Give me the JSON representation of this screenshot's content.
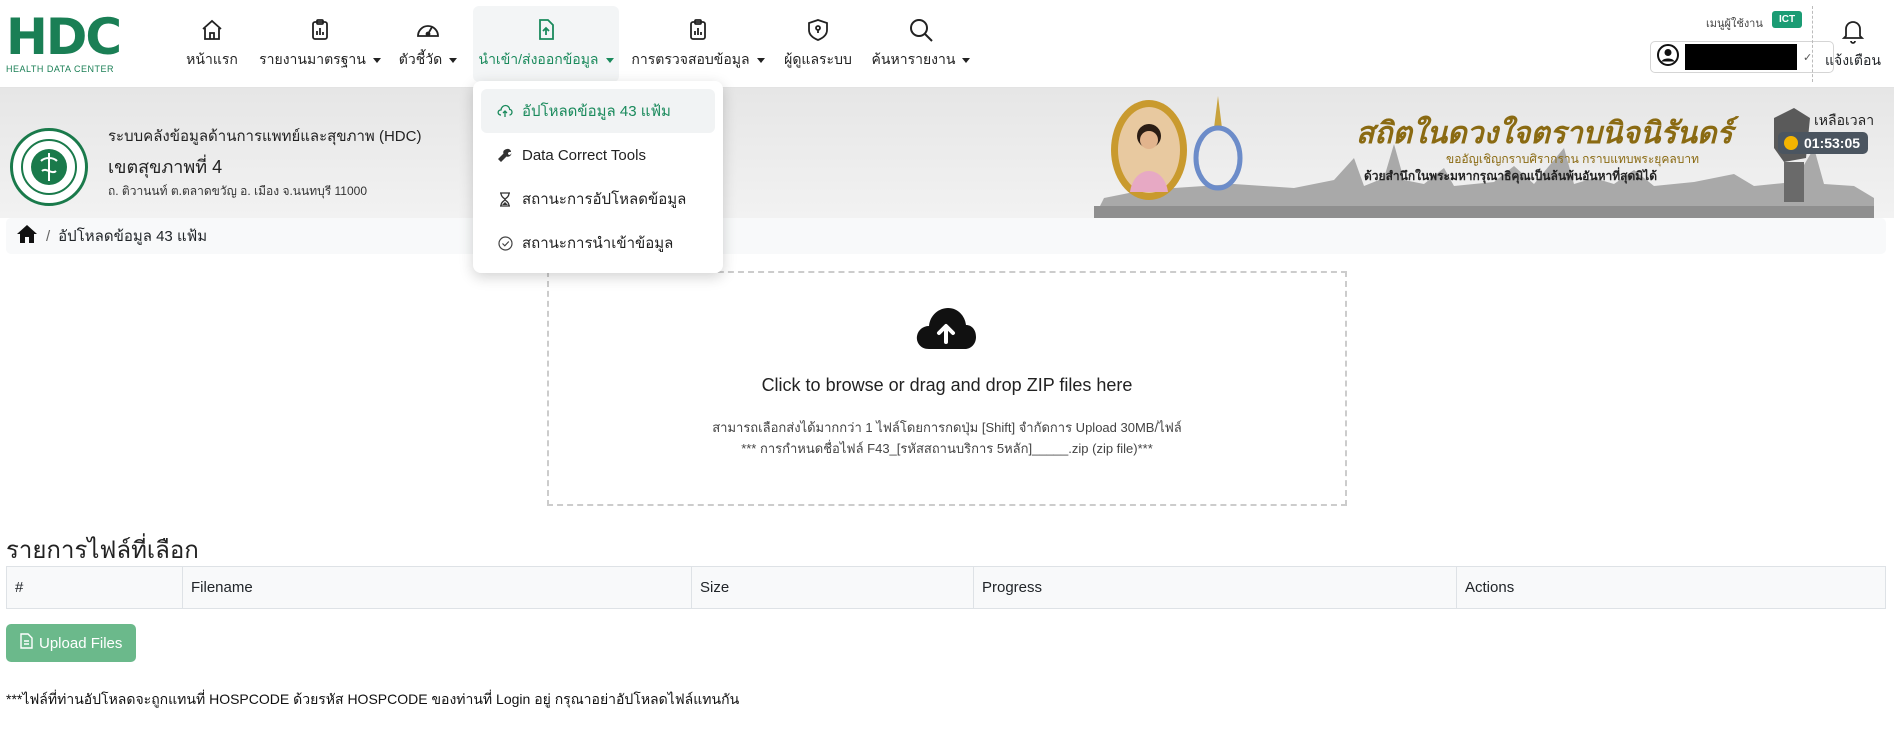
{
  "app": {
    "logo_text": "HDC",
    "logo_sub": "HEALTH DATA CENTER"
  },
  "nav": {
    "items": [
      {
        "label": "หน้าแรก",
        "icon": "home-icon"
      },
      {
        "label": "รายงานมาตรฐาน",
        "icon": "report-clipboard-icon"
      },
      {
        "label": "ตัวชี้วัด",
        "icon": "gauge-icon"
      },
      {
        "label": "นำเข้า/ส่งออกข้อมูล",
        "icon": "file-upload-icon"
      },
      {
        "label": "การตรวจสอบข้อมูล",
        "icon": "clipboard-check-icon"
      },
      {
        "label": "ผู้ดูแลระบบ",
        "icon": "shield-icon"
      },
      {
        "label": "ค้นหารายงาน",
        "icon": "search-icon"
      }
    ],
    "user_menu_label": "เมนูผู้ใช้งาน",
    "user_badge": "ICT",
    "notifications_label": "แจ้งเตือน"
  },
  "dropdown": {
    "items": [
      {
        "label": "อัปโหลดข้อมูล 43 แฟ้ม",
        "icon": "cloud-upload-icon"
      },
      {
        "label": "Data Correct Tools",
        "icon": "wrench-icon"
      },
      {
        "label": "สถานะการอัปโหลดข้อมูล",
        "icon": "hourglass-icon"
      },
      {
        "label": "สถานะการนำเข้าข้อมูล",
        "icon": "check-circle-icon"
      }
    ]
  },
  "header": {
    "site_name": "ระบบคลังข้อมูลด้านการแพทย์และสุขภาพ (HDC)",
    "region": "เขตสุขภาพที่ 4",
    "address": "ถ. ติวานนท์ ต.ตลาดขวัญ อ. เมือง จ.นนทบุรี 11000",
    "banner_title": "สถิตในดวงใจตราบนิจนิรันดร์",
    "banner_line1": "ขออัญเชิญกราบศิรากราน กราบแทบพระยุคลบาท",
    "banner_line2": "ด้วยสำนึกในพระมหากรุณาธิคุณเป็นล้นพ้นอันหาที่สุดมิได้",
    "time_left_label": "เหลือเวลา",
    "time_left": "01:53:05"
  },
  "breadcrumb": {
    "current": "อัปโหลดข้อมูล 43 แฟ้ม"
  },
  "dropzone": {
    "title": "Click to browse or drag and drop ZIP files here",
    "note1": "สามารถเลือกส่งได้มากกว่า 1 ไฟล์โดยการกดปุ่ม [Shift] จำกัดการ Upload 30MB/ไฟล์",
    "note2": "*** การกำหนดชื่อไฟล์ F43_[รหัสสถานบริการ 5หลัก]_____.zip (zip file)***"
  },
  "files": {
    "title": "รายการไฟล์ที่เลือก",
    "columns": [
      "#",
      "Filename",
      "Size",
      "Progress",
      "Actions"
    ],
    "upload_button": "Upload Files",
    "footnote": "***ไฟล์ที่ท่านอัปโหลดจะถูกแทนที่ HOSPCODE ด้วยรหัส HOSPCODE ของท่านที่ Login อยู่ กรุณาอย่าอัปโหลดไฟล์แทนกัน"
  },
  "colors": {
    "brand_green": "#1a8a5c",
    "upload_button": "#6bb98b",
    "badge": "#1b9c74"
  }
}
